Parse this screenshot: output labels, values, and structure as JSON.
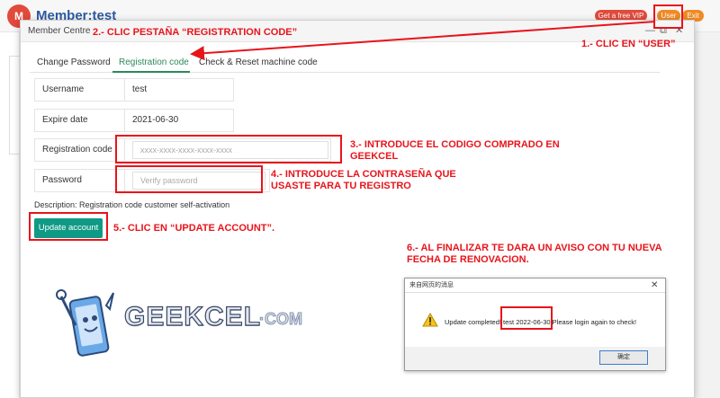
{
  "header": {
    "logo_text": "M",
    "member_title": "Member:test",
    "vip_label": "Get a free VIP",
    "user_label": "User",
    "exit_label": "Exit"
  },
  "modal": {
    "title": "Member Centre",
    "controls": {
      "minimize": "—",
      "maximize": "⧉",
      "close": "✕"
    },
    "tabs": [
      {
        "label": "Change Password",
        "active": false
      },
      {
        "label": "Registration code",
        "active": true
      },
      {
        "label": "Check & Reset machine code",
        "active": false
      }
    ],
    "fields": {
      "username": {
        "label": "Username",
        "value": "test"
      },
      "expire": {
        "label": "Expire date",
        "value": "2021-06-30"
      },
      "registration": {
        "label": "Registration code",
        "placeholder": "xxxx-xxxx-xxxx-xxxx-xxxx"
      },
      "password": {
        "label": "Password",
        "placeholder": "Verify password"
      }
    },
    "description": "Description: Registration code customer self-activation",
    "update_button": "Update account"
  },
  "annotations": {
    "step1": "1.- CLIC EN “USER”",
    "step2": "2.- CLIC PESTAÑA “REGISTRATION CODE”",
    "step3": "3.- INTRODUCE EL CODIGO COMPRADO EN GEEKCEL",
    "step4": "4.- INTRODUCE LA CONTRASEÑA QUE USASTE PARA TU REGISTRO",
    "step5": "5.- CLIC EN “UPDATE ACCOUNT”.",
    "step6": "6.- AL FINALIZAR TE DARA UN AVISO CON TU NUEVA FECHA DE RENOVACION.",
    "color": "#e8141b"
  },
  "watermark": {
    "brand": "GEEKCEL",
    "suffix": "·COM"
  },
  "dialog": {
    "title": "来自网页的消息",
    "message": "Update completed! test 2022-06-30 Please login again to check!",
    "ok_label": "确定"
  }
}
